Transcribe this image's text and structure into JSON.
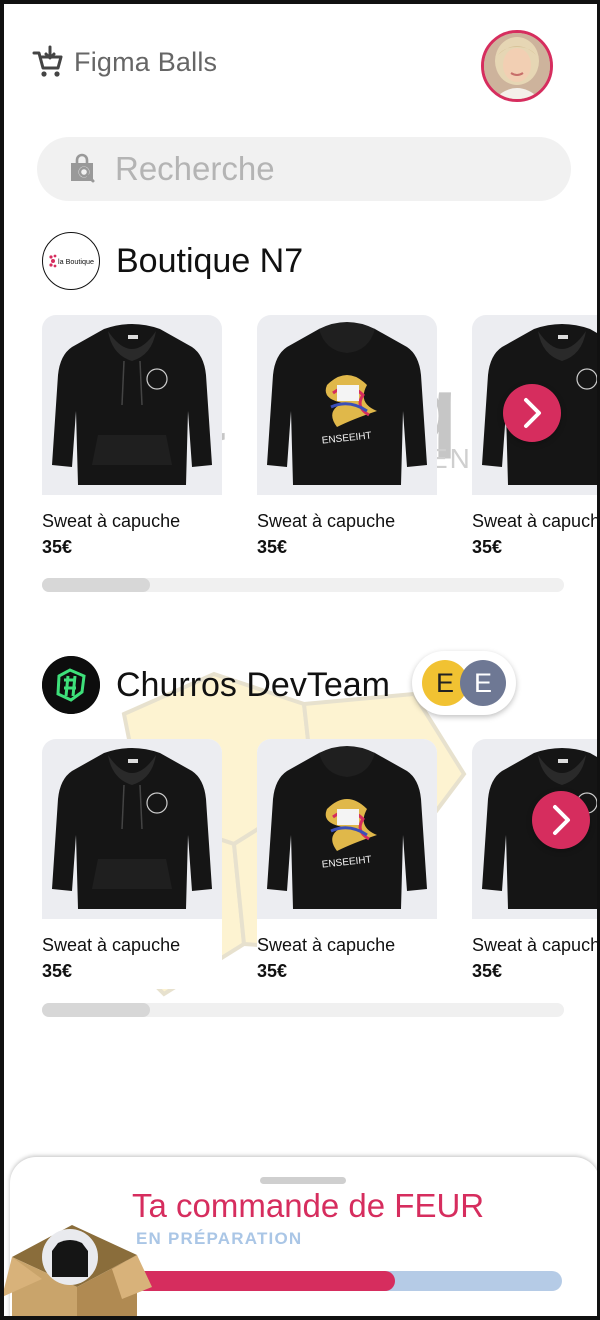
{
  "header": {
    "app_title": "Figma Balls",
    "cart_icon": "cart-icon",
    "avatar_alt": "user-avatar"
  },
  "search": {
    "placeholder": "Recherche",
    "icon": "shopping-bag-search-icon"
  },
  "shops": [
    {
      "name": "Boutique N7",
      "logo_text": "la Boutique",
      "products": [
        {
          "name": "Sweat à capuche",
          "price": "35€",
          "view": "front"
        },
        {
          "name": "Sweat à capuche",
          "price": "35€",
          "view": "back"
        },
        {
          "name": "Sweat à capuche",
          "price": "35€",
          "view": "front"
        }
      ]
    },
    {
      "name": "Churros DevTeam",
      "members": [
        "E",
        "E"
      ],
      "products": [
        {
          "name": "Sweat à capuche",
          "price": "35€",
          "view": "front"
        },
        {
          "name": "Sweat à capuche",
          "price": "35€",
          "view": "back"
        },
        {
          "name": "Sweat à capuche",
          "price": "35€",
          "view": "front"
        }
      ]
    }
  ],
  "hoodie_print": "ENSEEIHT",
  "order": {
    "title": "Ta commande de FEUR",
    "status": "EN PRÉPARATION",
    "progress": 0.61
  },
  "colors": {
    "accent": "#d62d5e",
    "progress_track": "#b5cbe6",
    "member_1": "#f1c232",
    "member_2": "#6e7894"
  }
}
